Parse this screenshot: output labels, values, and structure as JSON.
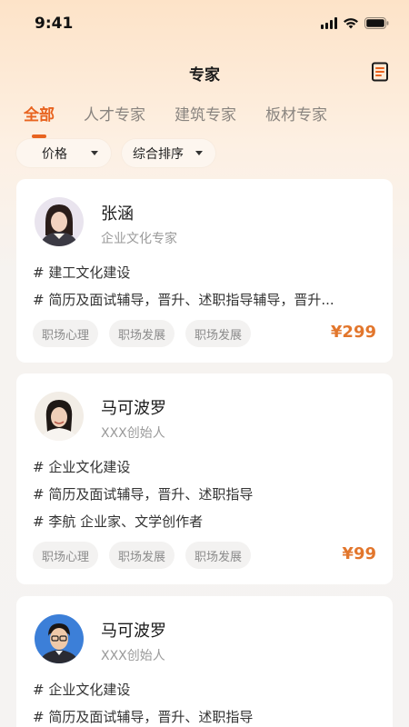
{
  "status": {
    "time": "9:41"
  },
  "nav": {
    "title": "专家"
  },
  "tabs": [
    {
      "label": "全部",
      "active": true
    },
    {
      "label": "人才专家",
      "active": false
    },
    {
      "label": "建筑专家",
      "active": false
    },
    {
      "label": "板材专家",
      "active": false
    }
  ],
  "filters": [
    {
      "label": "价格"
    },
    {
      "label": "综合排序"
    }
  ],
  "experts": [
    {
      "name": "张涵",
      "title": "企业文化专家",
      "lines": [
        "# 建工文化建设",
        "# 简历及面试辅导，晋升、述职指导辅导，晋升..."
      ],
      "chips": [
        "职场心理",
        "职场发展",
        "职场发展"
      ],
      "price": "¥299"
    },
    {
      "name": "马可波罗",
      "title": "XXX创始人",
      "lines": [
        "# 企业文化建设",
        "# 简历及面试辅导，晋升、述职指导",
        "# 李航 企业家、文学创作者"
      ],
      "chips": [
        "职场心理",
        "职场发展",
        "职场发展"
      ],
      "price": "¥99"
    },
    {
      "name": "马可波罗",
      "title": "XXX创始人",
      "lines": [
        "# 企业文化建设",
        "# 简历及面试辅导，晋升、述职指导"
      ],
      "chips": [],
      "price": ""
    }
  ],
  "icons": {
    "status": [
      "signal-icon",
      "wifi-icon",
      "battery-icon"
    ],
    "nav": "document-icon",
    "filters": "caret-down-icon"
  },
  "colors": {
    "accent": "#e8631f",
    "price": "#e2762c"
  }
}
